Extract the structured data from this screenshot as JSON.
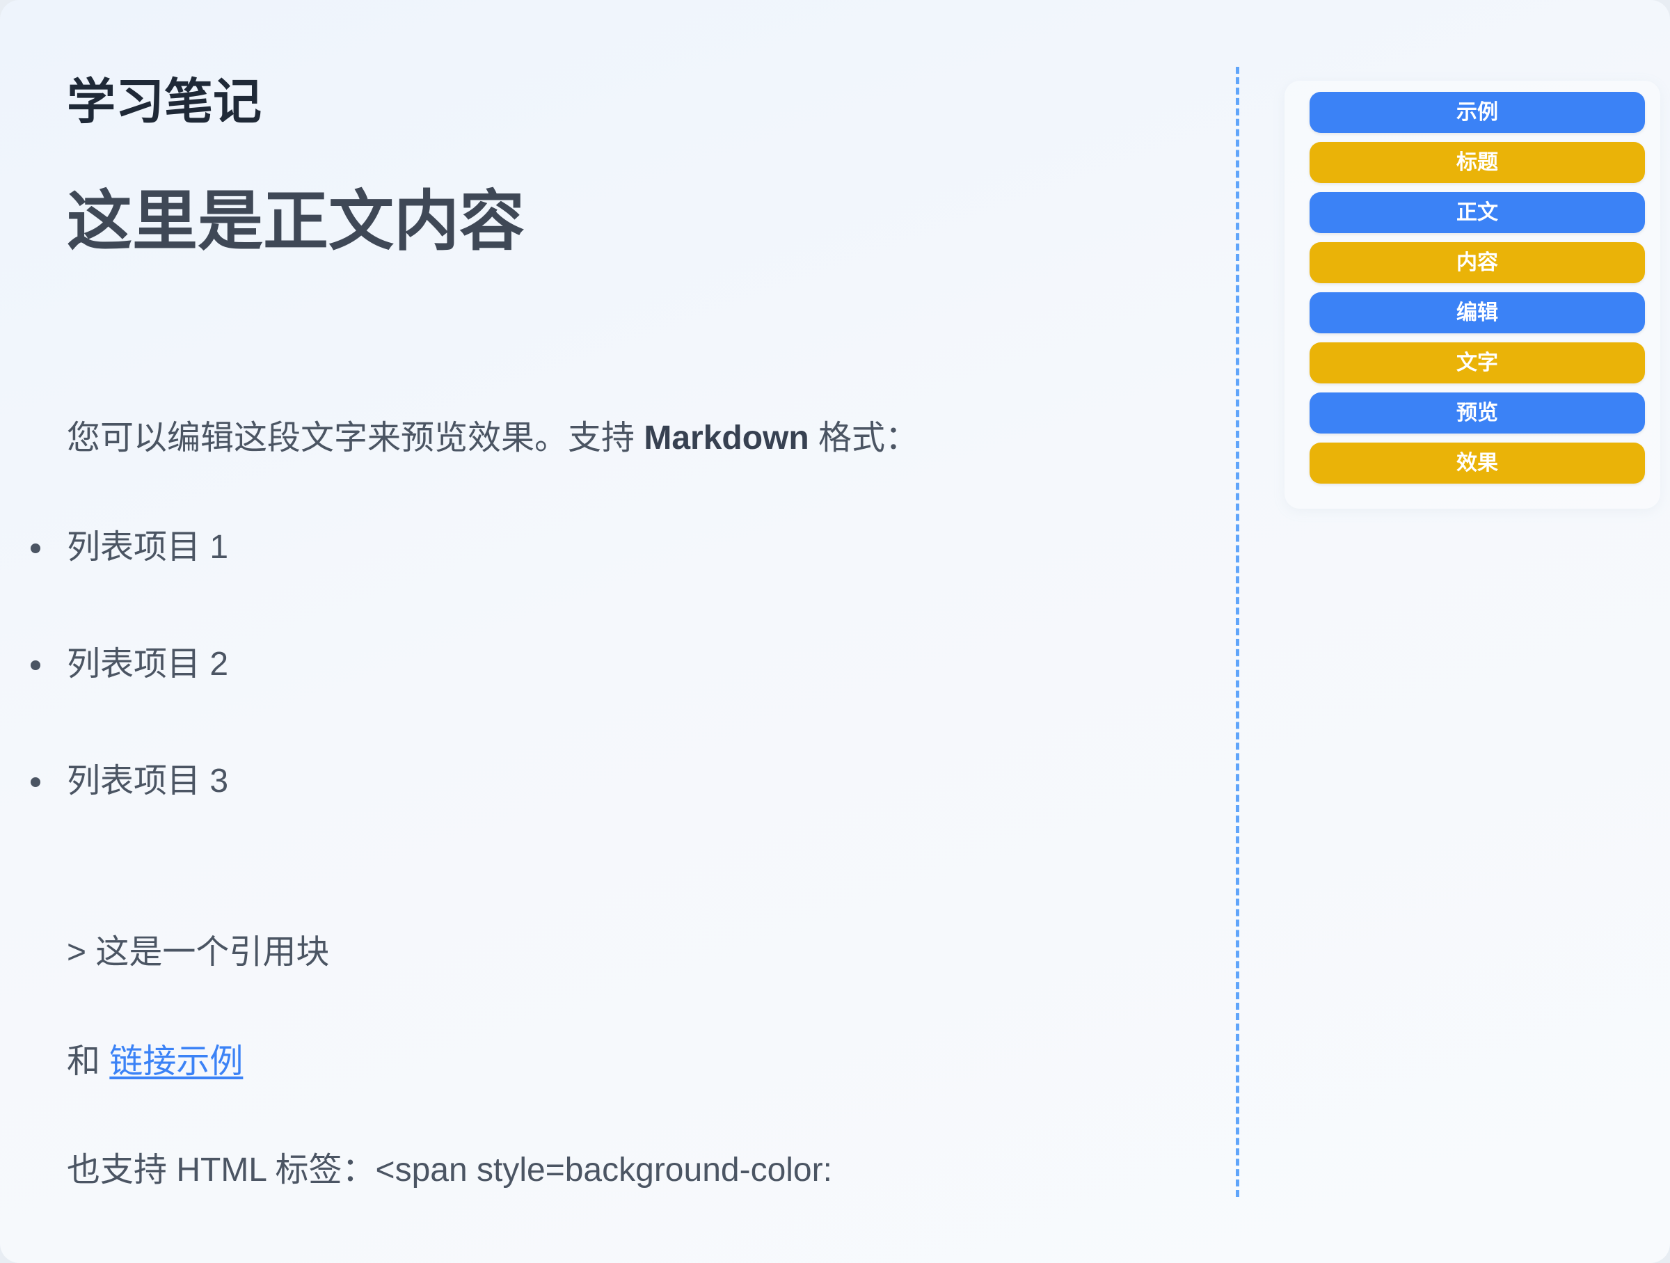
{
  "document": {
    "app_title": "学习笔记",
    "heading": "这里是正文内容",
    "intro": {
      "before": "您可以编辑这段文字来预览效果。支持 ",
      "bold": "Markdown",
      "after": " 格式："
    },
    "list_items": [
      "列表项目 1",
      "列表项目 2",
      "列表项目 3"
    ],
    "quote_line": "> 这是一个引用块",
    "link_line": {
      "prefix": "和 ",
      "link_text": "链接示例"
    },
    "html_line": "也支持 HTML 标签：<span style=background-color:"
  },
  "tags": [
    {
      "label": "示例",
      "color": "#3b82f6"
    },
    {
      "label": "标题",
      "color": "#eab308"
    },
    {
      "label": "正文",
      "color": "#3b82f6"
    },
    {
      "label": "内容",
      "color": "#eab308"
    },
    {
      "label": "编辑",
      "color": "#3b82f6"
    },
    {
      "label": "文字",
      "color": "#eab308"
    },
    {
      "label": "预览",
      "color": "#3b82f6"
    },
    {
      "label": "效果",
      "color": "#eab308"
    }
  ],
  "colors": {
    "divider": "#60a5fa",
    "link": "#3b82f6",
    "tag_blue": "#3b82f6",
    "tag_yellow": "#eab308"
  }
}
